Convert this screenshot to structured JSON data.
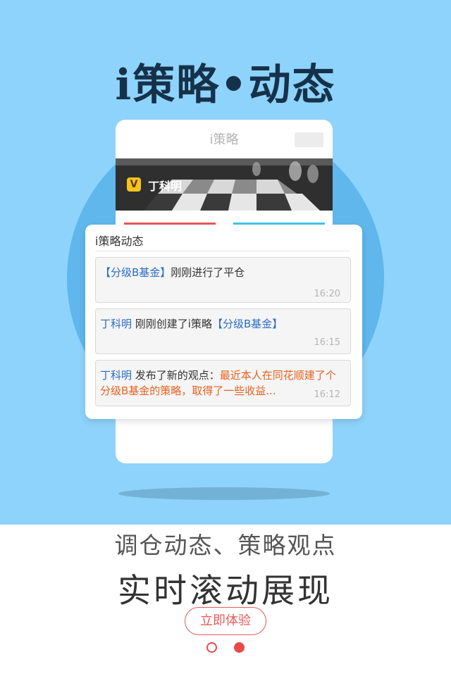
{
  "hero": {
    "title": "i策略•动态"
  },
  "phone": {
    "title": "i策略",
    "banner_badge": "V",
    "banner_name": "丁科明"
  },
  "card": {
    "title": "i策略动态",
    "items": [
      {
        "parts": [
          "【分级B基金】",
          "刚刚进行了平仓"
        ],
        "time": "16:20"
      },
      {
        "parts": [
          "丁科明",
          " 刚刚创建了i策略",
          "【分级B基金】"
        ],
        "time": "16:15"
      },
      {
        "parts": [
          "丁科明",
          " 发布了新的观点：",
          "最近本人在同花顺建了个分级B基金的策略，取得了一些收益..."
        ],
        "time": "16:12"
      }
    ]
  },
  "footer": {
    "subtitle": "调仓动态、策略观点",
    "headline": "实时滚动展现",
    "cta_label": "立即体验"
  },
  "colors": {
    "background": "#8ed3fb",
    "circle": "#5fb7ec",
    "accent_red": "#e84a4a",
    "link_blue": "#2a6cc4",
    "highlight_orange": "#e8611e"
  }
}
